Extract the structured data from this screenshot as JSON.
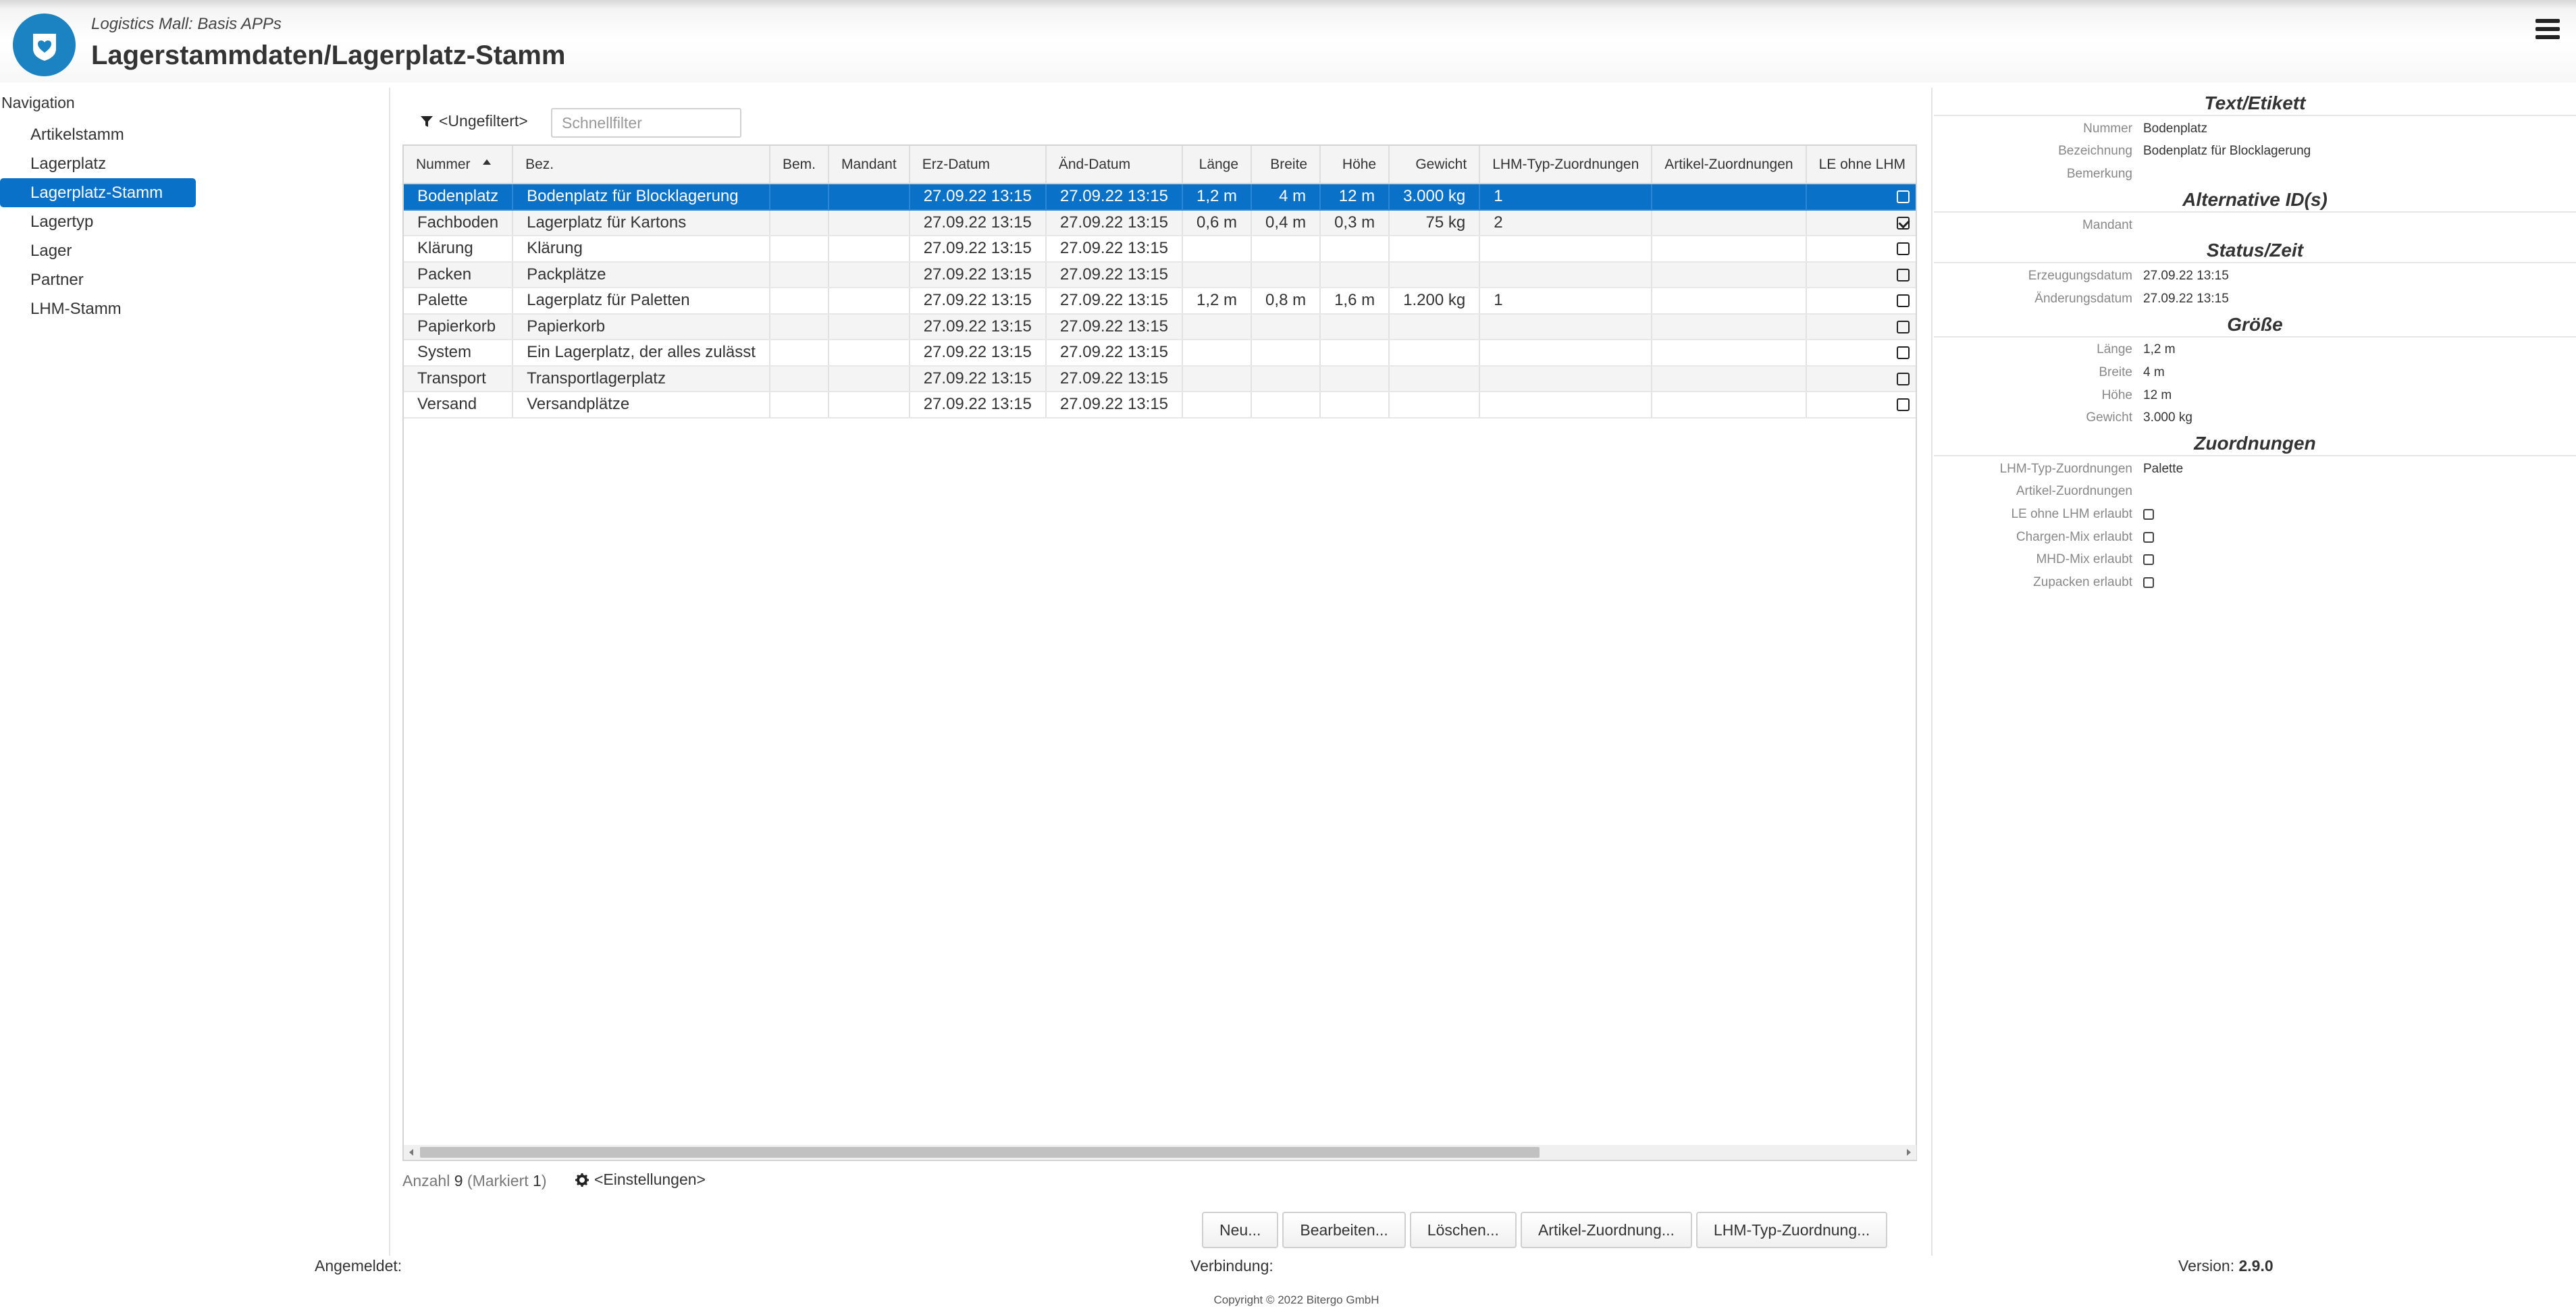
{
  "header": {
    "subtitle": "Logistics Mall: Basis APPs",
    "title": "Lagerstammdaten/Lagerplatz-Stamm"
  },
  "navigation": {
    "title": "Navigation",
    "items": [
      {
        "label": "Artikelstamm",
        "active": false
      },
      {
        "label": "Lagerplatz",
        "active": false
      },
      {
        "label": "Lagerplatz-Stamm",
        "active": true
      },
      {
        "label": "Lagertyp",
        "active": false
      },
      {
        "label": "Lager",
        "active": false
      },
      {
        "label": "Partner",
        "active": false
      },
      {
        "label": "LHM-Stamm",
        "active": false
      }
    ]
  },
  "toolbar": {
    "filter_label": "<Ungefiltert>",
    "quick_filter_placeholder": "Schnellfilter"
  },
  "table": {
    "columns": [
      "Nummer",
      "Bez.",
      "Bem.",
      "Mandant",
      "Erz-Datum",
      "Änd-Datum",
      "Länge",
      "Breite",
      "Höhe",
      "Gewicht",
      "LHM-Typ-Zuordnungen",
      "Artikel-Zuordnungen",
      "LE ohne LHM"
    ],
    "sorted_column": "Nummer",
    "rows": [
      {
        "nummer": "Bodenplatz",
        "bez": "Bodenplatz für Blocklagerung",
        "bem": "",
        "mandant": "",
        "erz": "27.09.22 13:15",
        "aend": "27.09.22 13:15",
        "laenge": "1,2 m",
        "breite": "4 m",
        "hoehe": "12 m",
        "gewicht": "3.000 kg",
        "lhm_typ": "1",
        "artikel": "",
        "le_ohne_lhm": false,
        "selected": true
      },
      {
        "nummer": "Fachboden",
        "bez": "Lagerplatz für Kartons",
        "bem": "",
        "mandant": "",
        "erz": "27.09.22 13:15",
        "aend": "27.09.22 13:15",
        "laenge": "0,6 m",
        "breite": "0,4 m",
        "hoehe": "0,3 m",
        "gewicht": "75 kg",
        "lhm_typ": "2",
        "artikel": "",
        "le_ohne_lhm": true,
        "selected": false
      },
      {
        "nummer": "Klärung",
        "bez": "Klärung",
        "bem": "",
        "mandant": "",
        "erz": "27.09.22 13:15",
        "aend": "27.09.22 13:15",
        "laenge": "",
        "breite": "",
        "hoehe": "",
        "gewicht": "",
        "lhm_typ": "",
        "artikel": "",
        "le_ohne_lhm": false,
        "selected": false
      },
      {
        "nummer": "Packen",
        "bez": "Packplätze",
        "bem": "",
        "mandant": "",
        "erz": "27.09.22 13:15",
        "aend": "27.09.22 13:15",
        "laenge": "",
        "breite": "",
        "hoehe": "",
        "gewicht": "",
        "lhm_typ": "",
        "artikel": "",
        "le_ohne_lhm": false,
        "selected": false
      },
      {
        "nummer": "Palette",
        "bez": "Lagerplatz für Paletten",
        "bem": "",
        "mandant": "",
        "erz": "27.09.22 13:15",
        "aend": "27.09.22 13:15",
        "laenge": "1,2 m",
        "breite": "0,8 m",
        "hoehe": "1,6 m",
        "gewicht": "1.200 kg",
        "lhm_typ": "1",
        "artikel": "",
        "le_ohne_lhm": false,
        "selected": false
      },
      {
        "nummer": "Papierkorb",
        "bez": "Papierkorb",
        "bem": "",
        "mandant": "",
        "erz": "27.09.22 13:15",
        "aend": "27.09.22 13:15",
        "laenge": "",
        "breite": "",
        "hoehe": "",
        "gewicht": "",
        "lhm_typ": "",
        "artikel": "",
        "le_ohne_lhm": false,
        "selected": false
      },
      {
        "nummer": "System",
        "bez": "Ein Lagerplatz, der alles zulässt",
        "bem": "",
        "mandant": "",
        "erz": "27.09.22 13:15",
        "aend": "27.09.22 13:15",
        "laenge": "",
        "breite": "",
        "hoehe": "",
        "gewicht": "",
        "lhm_typ": "",
        "artikel": "",
        "le_ohne_lhm": false,
        "selected": false
      },
      {
        "nummer": "Transport",
        "bez": "Transportlagerplatz",
        "bem": "",
        "mandant": "",
        "erz": "27.09.22 13:15",
        "aend": "27.09.22 13:15",
        "laenge": "",
        "breite": "",
        "hoehe": "",
        "gewicht": "",
        "lhm_typ": "",
        "artikel": "",
        "le_ohne_lhm": false,
        "selected": false
      },
      {
        "nummer": "Versand",
        "bez": "Versandplätze",
        "bem": "",
        "mandant": "",
        "erz": "27.09.22 13:15",
        "aend": "27.09.22 13:15",
        "laenge": "",
        "breite": "",
        "hoehe": "",
        "gewicht": "",
        "lhm_typ": "",
        "artikel": "",
        "le_ohne_lhm": false,
        "selected": false
      }
    ]
  },
  "table_footer": {
    "count_label": "Anzahl",
    "count": "9",
    "marked_label": "(Markiert",
    "marked": "1",
    "marked_close": ")",
    "settings_label": "<Einstellungen>"
  },
  "buttons": {
    "new": "Neu...",
    "edit": "Bearbeiten...",
    "delete": "Löschen...",
    "article_assign": "Artikel-Zuordnung...",
    "lhm_assign": "LHM-Typ-Zuordnung..."
  },
  "detail": {
    "sections": [
      {
        "title": "Text/Etikett",
        "rows": [
          {
            "label": "Nummer",
            "value": "Bodenplatz"
          },
          {
            "label": "Bezeichnung",
            "value": "Bodenplatz für Blocklagerung"
          },
          {
            "label": "Bemerkung",
            "value": ""
          }
        ]
      },
      {
        "title": "Alternative ID(s)",
        "rows": [
          {
            "label": "Mandant",
            "value": ""
          }
        ]
      },
      {
        "title": "Status/Zeit",
        "rows": [
          {
            "label": "Erzeugungsdatum",
            "value": "27.09.22 13:15"
          },
          {
            "label": "Änderungsdatum",
            "value": "27.09.22 13:15"
          }
        ]
      },
      {
        "title": "Größe",
        "rows": [
          {
            "label": "Länge",
            "value": "1,2 m"
          },
          {
            "label": "Breite",
            "value": "4 m"
          },
          {
            "label": "Höhe",
            "value": "12 m"
          },
          {
            "label": "Gewicht",
            "value": "3.000 kg"
          }
        ]
      },
      {
        "title": "Zuordnungen",
        "rows": [
          {
            "label": "LHM-Typ-Zuordnungen",
            "value": "Palette"
          },
          {
            "label": "Artikel-Zuordnungen",
            "value": ""
          },
          {
            "label": "LE ohne LHM erlaubt",
            "checkbox": false
          },
          {
            "label": "Chargen-Mix erlaubt",
            "checkbox": false
          },
          {
            "label": "MHD-Mix erlaubt",
            "checkbox": false
          },
          {
            "label": "Zupacken erlaubt",
            "checkbox": false
          }
        ]
      }
    ]
  },
  "status_bar": {
    "logged_in_label": "Angemeldet:",
    "connection_label": "Verbindung:",
    "version_label": "Version:",
    "version": "2.9.0",
    "copyright": "Copyright © 2022 Bitergo GmbH"
  },
  "colors": {
    "accent": "#0a71c8",
    "logo": "#1c83c3"
  }
}
